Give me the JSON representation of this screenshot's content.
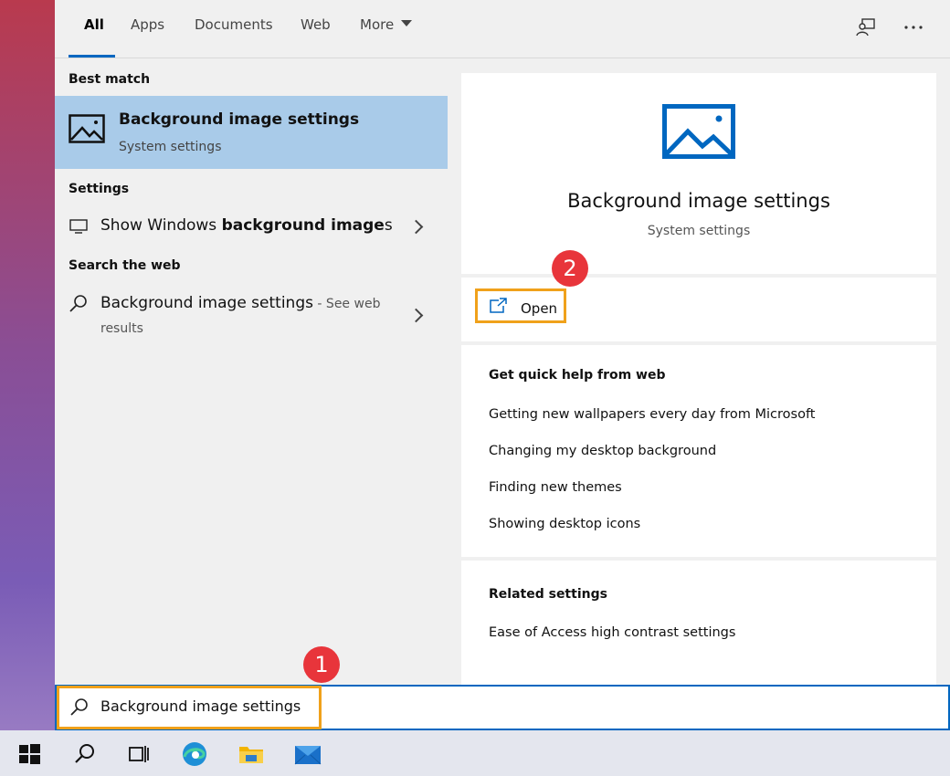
{
  "tabs": [
    {
      "label": "All",
      "active": true
    },
    {
      "label": "Apps"
    },
    {
      "label": "Documents"
    },
    {
      "label": "Web"
    },
    {
      "label": "More"
    }
  ],
  "top_icons": [
    "feedback-icon",
    "more-options-icon"
  ],
  "left": {
    "best_match_heading": "Best match",
    "best_match": {
      "title": "Background image settings",
      "subtitle": "System settings",
      "icon": "image-icon"
    },
    "settings_heading": "Settings",
    "settings_item": {
      "prefix": "Show Windows ",
      "bold": "background image",
      "suffix": "s",
      "icon": "monitor-icon"
    },
    "web_heading": "Search the web",
    "web_item": {
      "title": "Background image settings",
      "suffix": " - See web",
      "line2": "results",
      "icon": "search-icon"
    }
  },
  "right": {
    "hero": {
      "title": "Background image settings",
      "subtitle": "System settings",
      "icon": "image-icon"
    },
    "open_label": "Open",
    "quick_help_heading": "Get quick help from web",
    "quick_help_links": [
      "Getting new wallpapers every day from Microsoft",
      "Changing my desktop background",
      "Finding new themes",
      "Showing desktop icons"
    ],
    "related_heading": "Related settings",
    "related_links": [
      "Ease of Access high contrast settings"
    ]
  },
  "annotations": {
    "badge1": "1",
    "badge2": "2"
  },
  "search": {
    "value": "Background image settings"
  },
  "taskbar": [
    "windows-start-icon",
    "search-icon",
    "task-view-icon",
    "edge-icon",
    "file-explorer-icon",
    "mail-icon"
  ],
  "colors": {
    "accent": "#0067c0",
    "highlight_box": "#f0a11b",
    "badge": "#e8353b",
    "selected_row": "#a9cbe9"
  }
}
